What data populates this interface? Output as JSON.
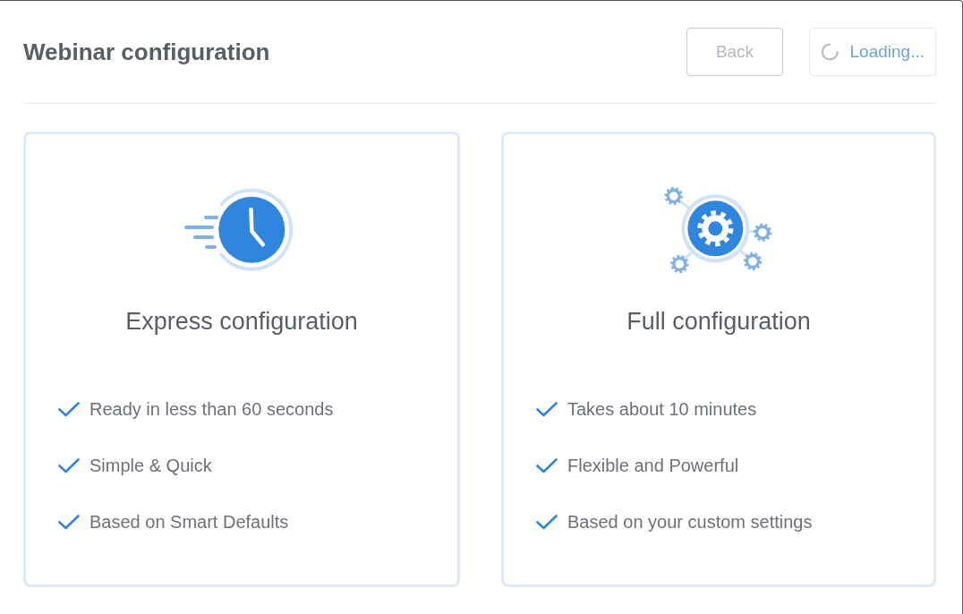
{
  "header": {
    "title": "Webinar configuration",
    "buttons": [
      {
        "label": "Back",
        "disabled": true,
        "loading": false
      },
      {
        "label": "Loading...",
        "disabled": false,
        "loading": true
      }
    ]
  },
  "options": [
    {
      "kind": "clock",
      "title": "Express configuration",
      "features": [
        "Ready in less than 60 seconds",
        "Simple & Quick",
        "Based on Smart Defaults"
      ]
    },
    {
      "kind": "gears",
      "title": "Full configuration",
      "features": [
        "Takes about 10 minutes",
        "Flexible and Powerful",
        "Based on your custom settings"
      ]
    }
  ]
}
